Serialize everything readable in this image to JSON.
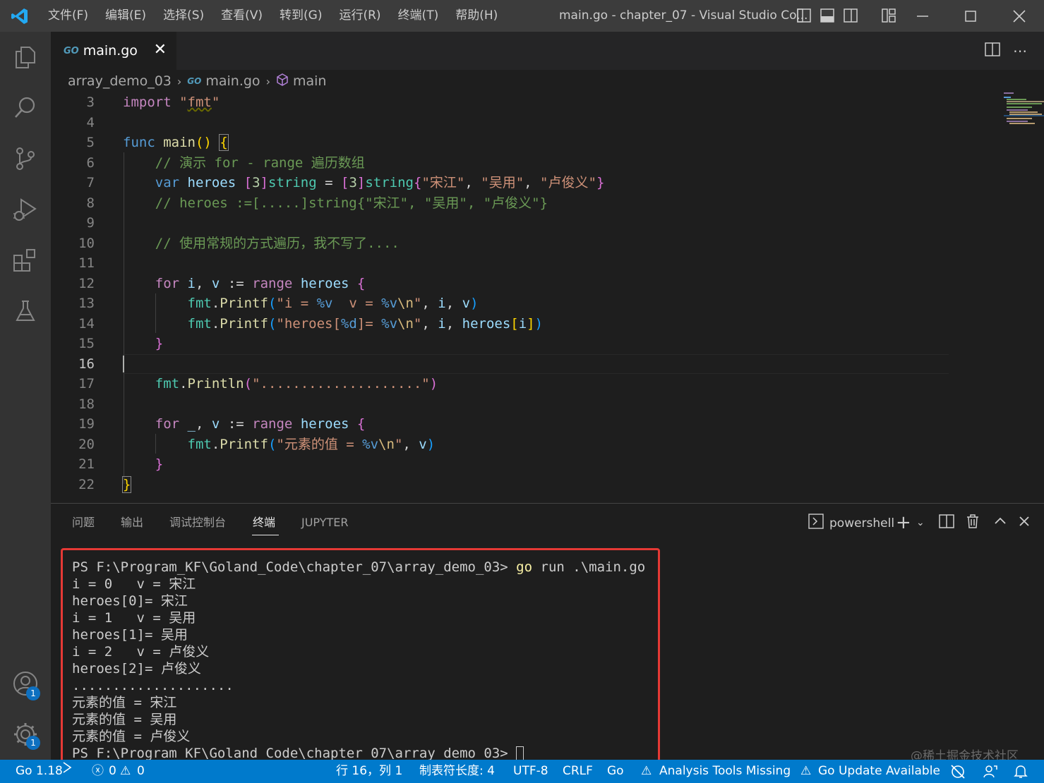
{
  "titlebar": {
    "menus": [
      "文件(F)",
      "编辑(E)",
      "选择(S)",
      "查看(V)",
      "转到(G)",
      "运行(R)",
      "终端(T)",
      "帮助(H)"
    ],
    "window_title": "main.go - chapter_07 - Visual Studio Co..."
  },
  "tab": {
    "icon_text": "GO",
    "label": "main.go",
    "close": "✕"
  },
  "breadcrumb": {
    "folder": "array_demo_03",
    "file_icon_text": "GO",
    "file": "main.go",
    "symbol": "main"
  },
  "editor": {
    "line_numbers": [
      "3",
      "4",
      "5",
      "6",
      "7",
      "8",
      "9",
      "10",
      "11",
      "12",
      "13",
      "14",
      "15",
      "16",
      "17",
      "18",
      "19",
      "20",
      "21",
      "22"
    ],
    "current_line": "16"
  },
  "panel": {
    "tabs": [
      "问题",
      "输出",
      "调试控制台",
      "终端",
      "JUPYTER"
    ],
    "active_tab": "终端",
    "shell": "powershell",
    "terminal_lines": [
      "i = 0   v = 宋江",
      "heroes[0]= 宋江",
      "i = 1   v = 吴用",
      "heroes[1]= 吴用",
      "i = 2   v = 卢俊义",
      "heroes[2]= 卢俊义",
      "....................",
      "元素的值 = 宋江",
      "元素的值 = 吴用",
      "元素的值 = 卢俊义"
    ],
    "prompt": "PS F:\\Program_KF\\Goland_Code\\chapter_07\\array_demo_03>",
    "command_word": "go",
    "command_rest": " run .\\main.go",
    "watermark": "@稀土掘金技术社区"
  },
  "activity": {
    "accounts_badge": "1",
    "settings_badge": "1"
  },
  "statusbar": {
    "go_version": "Go 1.18",
    "errors": "0",
    "warnings": "0",
    "position": "行 16，列 1",
    "indent": "制表符长度: 4",
    "encoding": "UTF-8",
    "eol": "CRLF",
    "language": "Go",
    "analysis": "Analysis Tools Missing",
    "update": "Go Update Available"
  },
  "colors": {
    "accent": "#007acc",
    "editor_bg": "#1e1e1e",
    "highlight_box": "#e53935"
  }
}
